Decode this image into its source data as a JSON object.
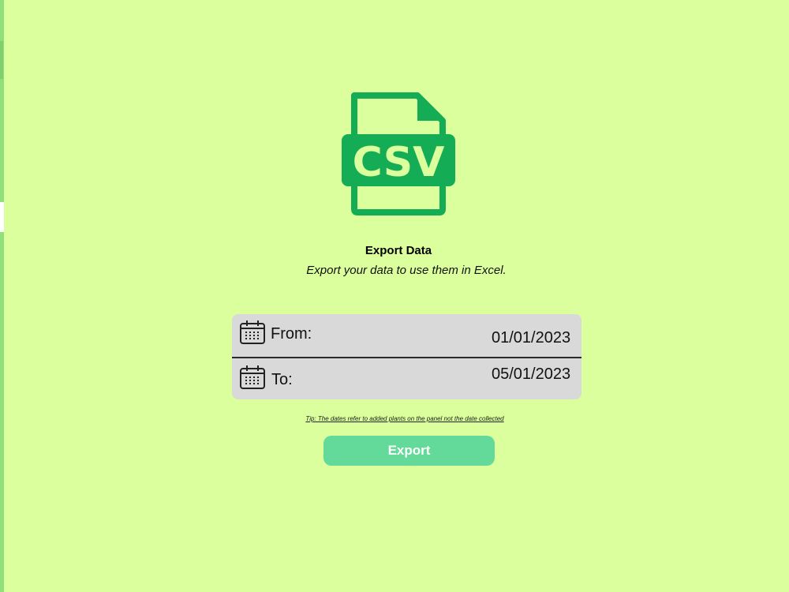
{
  "file_icon": {
    "text": "CSV",
    "color": "#14ad55",
    "text_color": "#daff9c"
  },
  "header": {
    "title": "Export Data",
    "subtitle": "Export your data to use them in Excel."
  },
  "date_range": {
    "from": {
      "label": "From:",
      "value": "01/01/2023",
      "icon": "calendar-icon"
    },
    "to": {
      "label": "To:",
      "value": "05/01/2023",
      "icon": "calendar-icon"
    }
  },
  "tip": "Tip: The dates refer to added plants on the panel not the date collected",
  "actions": {
    "export_label": "Export"
  },
  "colors": {
    "background": "#daff9c",
    "panel": "#d9d9d9",
    "button": "#63d99a"
  }
}
